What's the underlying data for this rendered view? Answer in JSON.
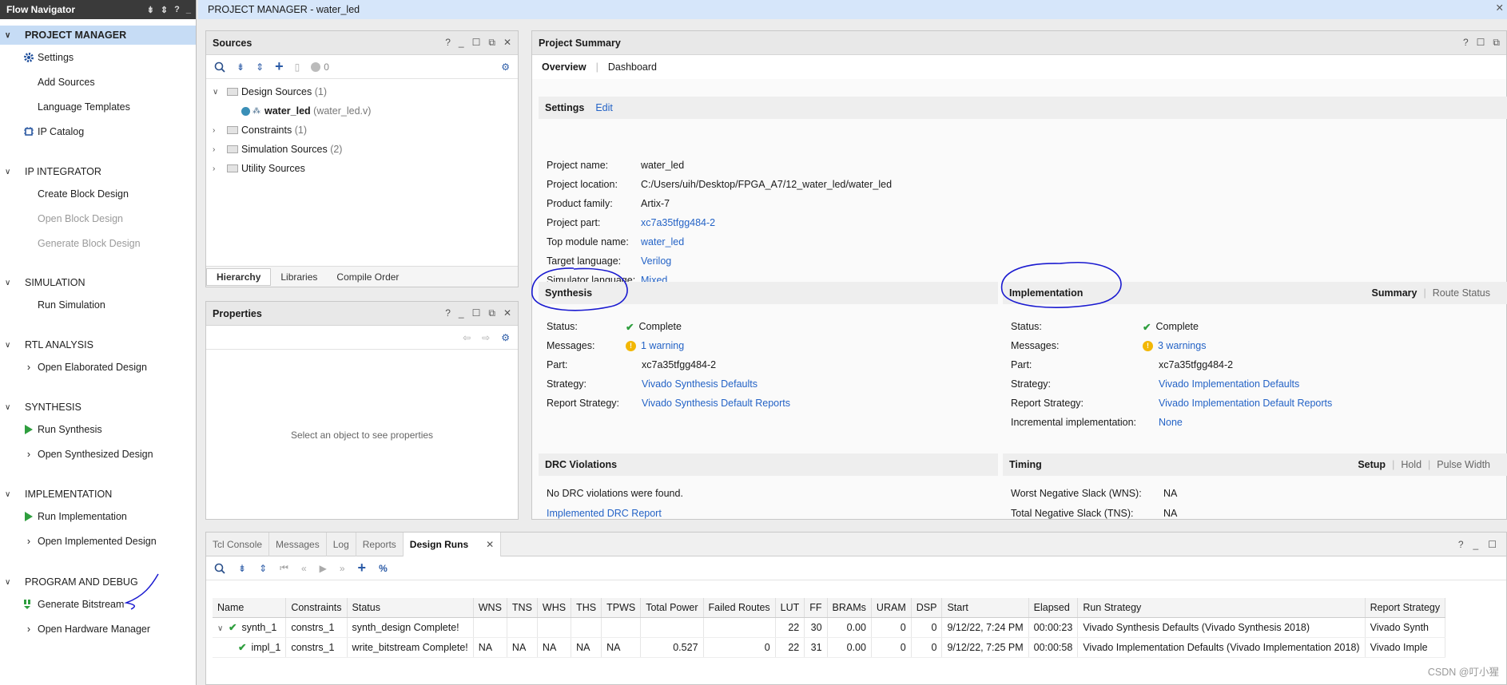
{
  "flow_navigator": {
    "title": "Flow Navigator",
    "sections": [
      {
        "title": "PROJECT MANAGER",
        "items": [
          "Settings",
          "Add Sources",
          "Language Templates",
          "IP Catalog"
        ]
      },
      {
        "title": "IP INTEGRATOR",
        "items": [
          "Create Block Design",
          "Open Block Design",
          "Generate Block Design"
        ]
      },
      {
        "title": "SIMULATION",
        "items": [
          "Run Simulation"
        ]
      },
      {
        "title": "RTL ANALYSIS",
        "items": [
          "Open Elaborated Design"
        ]
      },
      {
        "title": "SYNTHESIS",
        "items": [
          "Run Synthesis",
          "Open Synthesized Design"
        ]
      },
      {
        "title": "IMPLEMENTATION",
        "items": [
          "Run Implementation",
          "Open Implemented Design"
        ]
      },
      {
        "title": "PROGRAM AND DEBUG",
        "items": [
          "Generate Bitstream",
          "Open Hardware Manager"
        ]
      }
    ]
  },
  "topbar": {
    "title": "PROJECT MANAGER - water_led"
  },
  "sources": {
    "title": "Sources",
    "count": "0",
    "tree": {
      "design": "Design Sources",
      "design_count": "(1)",
      "top_name": "water_led",
      "top_file": "(water_led.v)",
      "constraints": "Constraints",
      "constraints_count": "(1)",
      "sim": "Simulation Sources",
      "sim_count": "(2)",
      "utility": "Utility Sources"
    },
    "tabs": [
      "Hierarchy",
      "Libraries",
      "Compile Order"
    ]
  },
  "properties": {
    "title": "Properties",
    "empty_text": "Select an object to see properties"
  },
  "summary": {
    "title": "Project Summary",
    "tabs": [
      "Overview",
      "Dashboard"
    ],
    "settings": {
      "header": "Settings",
      "edit": "Edit",
      "rows": [
        [
          "Project name:",
          "water_led"
        ],
        [
          "Project location:",
          "C:/Users/uih/Desktop/FPGA_A7/12_water_led/water_led"
        ],
        [
          "Product family:",
          "Artix-7"
        ],
        [
          "Project part:",
          "xc7a35tfgg484-2"
        ],
        [
          "Top module name:",
          "water_led"
        ],
        [
          "Target language:",
          "Verilog"
        ],
        [
          "Simulator language:",
          "Mixed"
        ]
      ]
    },
    "synthesis": {
      "header": "Synthesis",
      "status_label": "Status:",
      "status": "Complete",
      "messages_label": "Messages:",
      "messages": "1 warning",
      "part_label": "Part:",
      "part": "xc7a35tfgg484-2",
      "strategy_label": "Strategy:",
      "strategy": "Vivado Synthesis Defaults",
      "report_label": "Report Strategy:",
      "report": "Vivado Synthesis Default Reports"
    },
    "implementation": {
      "header": "Implementation",
      "summary_tab": "Summary",
      "route_tab": "Route Status",
      "status_label": "Status:",
      "status": "Complete",
      "messages_label": "Messages:",
      "messages": "3 warnings",
      "part_label": "Part:",
      "part": "xc7a35tfgg484-2",
      "strategy_label": "Strategy:",
      "strategy": "Vivado Implementation Defaults",
      "report_label": "Report Strategy:",
      "report": "Vivado Implementation Default Reports",
      "incr_label": "Incremental implementation:",
      "incr": "None"
    },
    "drc": {
      "header": "DRC Violations",
      "text": "No DRC violations were found.",
      "link": "Implemented DRC Report"
    },
    "timing": {
      "header": "Timing",
      "tabs": [
        "Setup",
        "Hold",
        "Pulse Width"
      ],
      "wns_label": "Worst Negative Slack (WNS):",
      "wns": "NA",
      "tns_label": "Total Negative Slack (TNS):",
      "tns": "NA"
    }
  },
  "bottom": {
    "tabs": [
      "Tcl Console",
      "Messages",
      "Log",
      "Reports",
      "Design Runs"
    ],
    "columns": [
      "Name",
      "Constraints",
      "Status",
      "WNS",
      "TNS",
      "WHS",
      "THS",
      "TPWS",
      "Total Power",
      "Failed Routes",
      "LUT",
      "FF",
      "BRAMs",
      "URAM",
      "DSP",
      "Start",
      "Elapsed",
      "Run Strategy",
      "Report Strategy"
    ],
    "rows": [
      [
        "synth_1",
        "constrs_1",
        "synth_design Complete!",
        "",
        "",
        "",
        "",
        "",
        "",
        "",
        "22",
        "30",
        "0.00",
        "0",
        "0",
        "9/12/22, 7:24 PM",
        "00:00:23",
        "Vivado Synthesis Defaults (Vivado Synthesis 2018)",
        "Vivado Synth"
      ],
      [
        "impl_1",
        "constrs_1",
        "write_bitstream Complete!",
        "NA",
        "NA",
        "NA",
        "NA",
        "NA",
        "0.527",
        "0",
        "22",
        "31",
        "0.00",
        "0",
        "0",
        "9/12/22, 7:25 PM",
        "00:00:58",
        "Vivado Implementation Defaults (Vivado Implementation 2018)",
        "Vivado Imple"
      ]
    ]
  },
  "watermark": "CSDN @叮小猩"
}
